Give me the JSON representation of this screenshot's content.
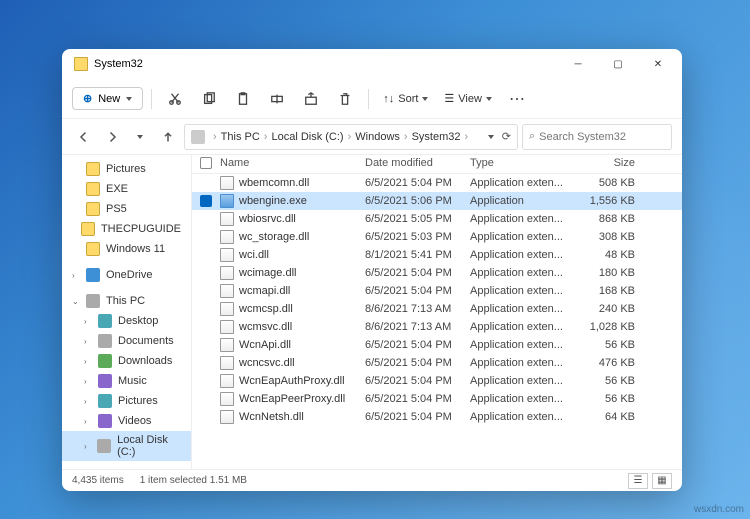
{
  "window": {
    "title": "System32"
  },
  "toolbar": {
    "new": "New",
    "sort": "Sort",
    "view": "View"
  },
  "breadcrumb": [
    "This PC",
    "Local Disk (C:)",
    "Windows",
    "System32"
  ],
  "search": {
    "placeholder": "Search System32"
  },
  "sidebar": {
    "quick": [
      {
        "label": "Pictures",
        "ico": "ico-yellow"
      },
      {
        "label": "EXE",
        "ico": "ico-yellow"
      },
      {
        "label": "PS5",
        "ico": "ico-yellow"
      },
      {
        "label": "THECPUGUIDE",
        "ico": "ico-yellow"
      },
      {
        "label": "Windows 11",
        "ico": "ico-yellow"
      }
    ],
    "onedrive": {
      "label": "OneDrive",
      "ico": "ico-blue"
    },
    "thispc": {
      "label": "This PC",
      "ico": "ico-gray"
    },
    "drives": [
      {
        "label": "Desktop",
        "ico": "ico-teal"
      },
      {
        "label": "Documents",
        "ico": "ico-gray"
      },
      {
        "label": "Downloads",
        "ico": "ico-green"
      },
      {
        "label": "Music",
        "ico": "ico-purple"
      },
      {
        "label": "Pictures",
        "ico": "ico-teal"
      },
      {
        "label": "Videos",
        "ico": "ico-purple"
      },
      {
        "label": "Local Disk (C:)",
        "ico": "ico-gray",
        "selected": true
      }
    ]
  },
  "columns": {
    "name": "Name",
    "date": "Date modified",
    "type": "Type",
    "size": "Size"
  },
  "files": [
    {
      "name": "wbemcomn.dll",
      "date": "6/5/2021 5:04 PM",
      "type": "Application exten...",
      "size": "508 KB"
    },
    {
      "name": "wbengine.exe",
      "date": "6/5/2021 5:06 PM",
      "type": "Application",
      "size": "1,556 KB",
      "selected": true,
      "exe": true
    },
    {
      "name": "wbiosrvc.dll",
      "date": "6/5/2021 5:05 PM",
      "type": "Application exten...",
      "size": "868 KB"
    },
    {
      "name": "wc_storage.dll",
      "date": "6/5/2021 5:03 PM",
      "type": "Application exten...",
      "size": "308 KB"
    },
    {
      "name": "wci.dll",
      "date": "8/1/2021 5:41 PM",
      "type": "Application exten...",
      "size": "48 KB"
    },
    {
      "name": "wcimage.dll",
      "date": "6/5/2021 5:04 PM",
      "type": "Application exten...",
      "size": "180 KB"
    },
    {
      "name": "wcmapi.dll",
      "date": "6/5/2021 5:04 PM",
      "type": "Application exten...",
      "size": "168 KB"
    },
    {
      "name": "wcmcsp.dll",
      "date": "8/6/2021 7:13 AM",
      "type": "Application exten...",
      "size": "240 KB"
    },
    {
      "name": "wcmsvc.dll",
      "date": "8/6/2021 7:13 AM",
      "type": "Application exten...",
      "size": "1,028 KB"
    },
    {
      "name": "WcnApi.dll",
      "date": "6/5/2021 5:04 PM",
      "type": "Application exten...",
      "size": "56 KB"
    },
    {
      "name": "wcncsvc.dll",
      "date": "6/5/2021 5:04 PM",
      "type": "Application exten...",
      "size": "476 KB"
    },
    {
      "name": "WcnEapAuthProxy.dll",
      "date": "6/5/2021 5:04 PM",
      "type": "Application exten...",
      "size": "56 KB"
    },
    {
      "name": "WcnEapPeerProxy.dll",
      "date": "6/5/2021 5:04 PM",
      "type": "Application exten...",
      "size": "56 KB"
    },
    {
      "name": "WcnNetsh.dll",
      "date": "6/5/2021 5:04 PM",
      "type": "Application exten...",
      "size": "64 KB"
    }
  ],
  "status": {
    "items": "4,435 items",
    "selected": "1 item selected  1.51 MB"
  },
  "watermark": "wsxdn.com"
}
